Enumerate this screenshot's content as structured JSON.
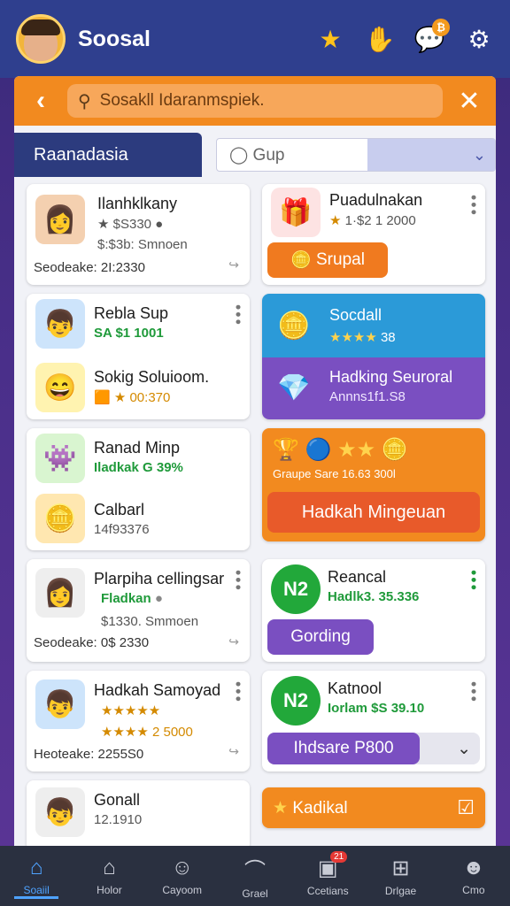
{
  "app": {
    "title": "Soosal"
  },
  "search": {
    "placeholder": "Sosakll Idaranmspiek."
  },
  "tabs": {
    "active": "Raanadasia",
    "group_select": "Gup"
  },
  "cards": {
    "c1": {
      "title": "Ilanhklkany",
      "line1": "S330",
      "line2": "$:$3b: Smnoen",
      "line3": "Seodeake: 2I:2330"
    },
    "c2": {
      "title": "Puadulnakan",
      "line1": "1·$2 1 2000",
      "button": "Srupal"
    },
    "c3": {
      "title": "Rebla Sup",
      "line1": "SA $1 1001",
      "title2": "Sokig Soluioom.",
      "line2": "00:370"
    },
    "c4": {
      "title": "Socdall",
      "line1": "38",
      "title2": "Hadking Seuroral",
      "line2": "Annns1f1.S8"
    },
    "c5": {
      "title": "Ranad Minp",
      "line1": "Iladkak G 39%",
      "title2": "Calbarl",
      "line2": "14f93376"
    },
    "c6": {
      "line1": "Graupe Sare 16.63 300l",
      "button": "Hadkah Mingeuan"
    },
    "c7": {
      "title": "Plarpiha cellingsar",
      "line1": "Fladkan",
      "line2": "$1330. Smmoen",
      "line3": "Seodeake: 0$ 2330"
    },
    "c8": {
      "badge": "N2",
      "title": "Reancal",
      "line1": "Hadlk3. 35.336",
      "button": "Gording"
    },
    "c9": {
      "title": "Hadkah Samoyad",
      "line1": "2 5000",
      "line3": "Heoteake: 2255S0"
    },
    "c10": {
      "badge": "N2",
      "title": "Katnool",
      "line1": "Iorlam $S 39.10",
      "select": "Ihdsare P800"
    },
    "c11": {
      "title": "Gonall",
      "line1": "12.1910"
    },
    "c12": {
      "label": "Kadikal"
    }
  },
  "nav": [
    {
      "label": "Soaiil",
      "icon": "home-icon"
    },
    {
      "label": "Holor",
      "icon": "house-icon"
    },
    {
      "label": "Cayoom",
      "icon": "smile-icon"
    },
    {
      "label": "Grael",
      "icon": "arch-icon"
    },
    {
      "label": "Ccetians",
      "icon": "tablet-icon",
      "badge": "21"
    },
    {
      "label": "Drlgae",
      "icon": "gift-icon"
    },
    {
      "label": "Cmo",
      "icon": "user-icon"
    }
  ],
  "colors": {
    "topbar": "#2f3f8e",
    "orange": "#f28a1f",
    "purple": "#7a4fc1",
    "blue": "#2b9ad8",
    "green": "#1f9a3a"
  }
}
